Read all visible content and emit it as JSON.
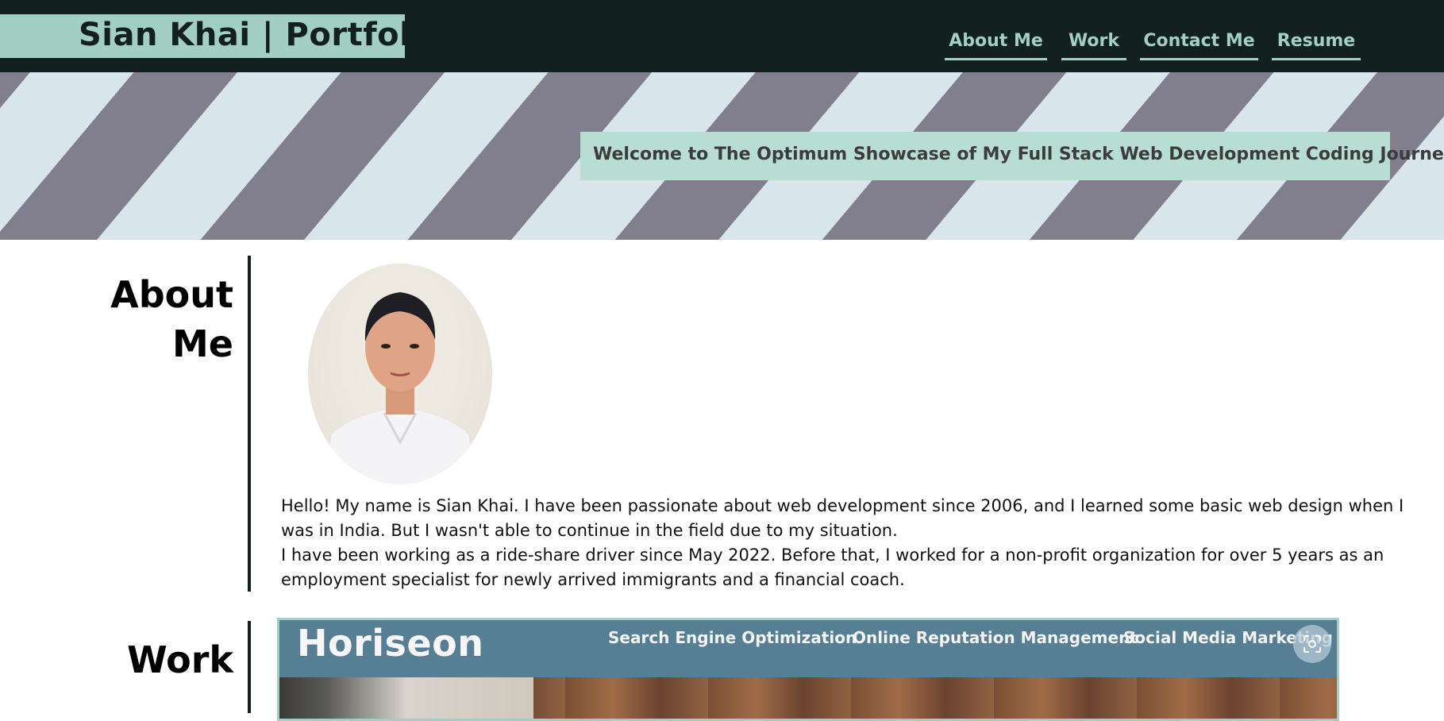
{
  "header": {
    "brand": "Sian Khai | Portfolio",
    "nav": [
      {
        "label": "About Me"
      },
      {
        "label": "Work"
      },
      {
        "label": "Contact Me"
      },
      {
        "label": "Resume"
      }
    ]
  },
  "hero": {
    "welcome": "Welcome to The Optimum Showcase of My Full Stack Web Development Coding Journey."
  },
  "about": {
    "title_line1": "About",
    "title_line2": "Me",
    "portrait_alt": "portrait photo",
    "paragraph1": "Hello! My name is Sian Khai. I have been passionate about web development since 2006, and I learned some basic web design when I was in India. But I wasn't able to continue in the field due to my situation.",
    "paragraph2": "I have been working as a ride-share driver since May 2022. Before that, I worked for a non-profit organization for over 5 years as an employment specialist for newly arrived immigrants and a financial coach."
  },
  "work": {
    "title": "Work",
    "preview": {
      "logo": "Horiseon",
      "nav": [
        "Search Engine Optimization",
        "Online Reputation Management",
        "Social Media Marketing"
      ]
    }
  },
  "colors": {
    "header_bg": "#12201f",
    "accent": "#a3cfc3",
    "hero_light": "#d8e6ec",
    "hero_dark": "#817f8d",
    "welcome_bg": "#b8ddd3",
    "horiseon_bar": "#567f93"
  },
  "icons": {
    "capture": "screenshot-capture-icon"
  }
}
